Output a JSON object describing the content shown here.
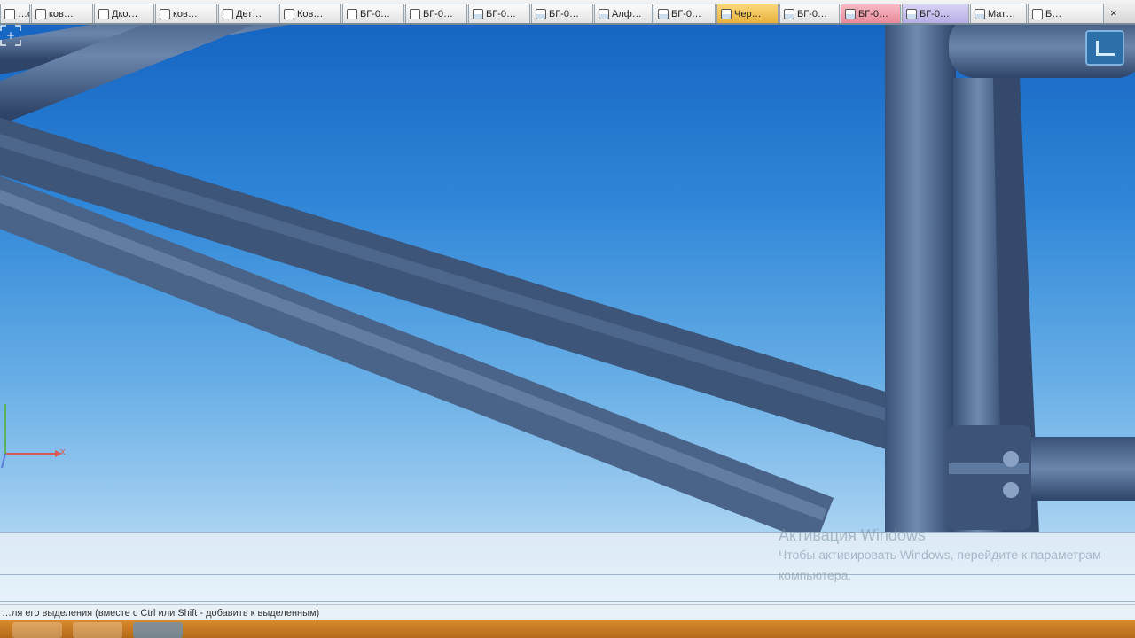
{
  "tabs": [
    {
      "label": "…о…",
      "icon": "part-icon",
      "color": "default"
    },
    {
      "label": "ков…",
      "icon": "part-icon",
      "color": "default"
    },
    {
      "label": "Дко…",
      "icon": "part-icon",
      "color": "default"
    },
    {
      "label": "ков…",
      "icon": "part-icon",
      "color": "default"
    },
    {
      "label": "Дет…",
      "icon": "part-icon",
      "color": "default"
    },
    {
      "label": "Ков…",
      "icon": "part-icon",
      "color": "default"
    },
    {
      "label": "БГ-0…",
      "icon": "assembly-icon",
      "color": "default"
    },
    {
      "label": "БГ-0…",
      "icon": "assembly-icon",
      "color": "default"
    },
    {
      "label": "БГ-0…",
      "icon": "drawing-icon",
      "color": "default"
    },
    {
      "label": "БГ-0…",
      "icon": "drawing-icon",
      "color": "default"
    },
    {
      "label": "Алф…",
      "icon": "drawing-icon",
      "color": "default"
    },
    {
      "label": "БГ-0…",
      "icon": "drawing-icon",
      "color": "default"
    },
    {
      "label": "Чер…",
      "icon": "drawing-icon",
      "color": "orange"
    },
    {
      "label": "БГ-0…",
      "icon": "drawing-icon",
      "color": "default"
    },
    {
      "label": "БГ-0…",
      "icon": "drawing-icon",
      "color": "pink"
    },
    {
      "label": "БГ-0…",
      "icon": "drawing-icon",
      "color": "lilac"
    },
    {
      "label": "Мат…",
      "icon": "drawing-icon",
      "color": "default"
    },
    {
      "label": "Б…",
      "icon": "assembly-icon",
      "color": "default"
    }
  ],
  "tab_close": "×",
  "viewport": {
    "axis_x_label": "x",
    "background_top": "#1565c2",
    "background_bottom": "#a9d2f2",
    "pipe_color": "#4a6489"
  },
  "watermark": {
    "title": "Активация Windows",
    "text": "Чтобы активировать Windows, перейдите к параметрам компьютера."
  },
  "status": {
    "text": "…ля его выделения (вместе с Ctrl или Shift - добавить к выделенным)"
  },
  "taskbar": {
    "color": "#c97a25"
  }
}
